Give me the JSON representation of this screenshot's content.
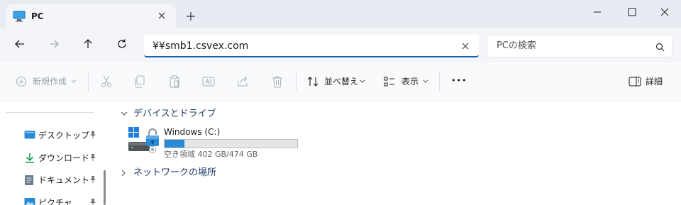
{
  "tab": {
    "title": "PC"
  },
  "address": {
    "value": "¥¥smb1.csvex.com"
  },
  "search": {
    "placeholder": "PCの検索"
  },
  "commands": {
    "new": "新規作成",
    "sort": "並べ替え",
    "view": "表示",
    "more": "•••",
    "details": "詳細"
  },
  "sidebar": {
    "items": [
      {
        "label": "デスクトップ",
        "icon": "desktop-icon"
      },
      {
        "label": "ダウンロード",
        "icon": "download-icon"
      },
      {
        "label": "ドキュメント",
        "icon": "document-icon"
      },
      {
        "label": "ピクチャ",
        "icon": "pictures-icon"
      }
    ]
  },
  "content": {
    "groups": [
      {
        "label": "デバイスとドライブ"
      },
      {
        "label": "ネットワークの場所"
      }
    ],
    "drive": {
      "name": "Windows (C:)",
      "space": "空き領域 402 GB/474 GB",
      "used_fraction": 0.15
    }
  },
  "colors": {
    "accent": "#1a5fb4",
    "usage_bar": "#2a8ad6",
    "group_text": "#1f3a68"
  }
}
